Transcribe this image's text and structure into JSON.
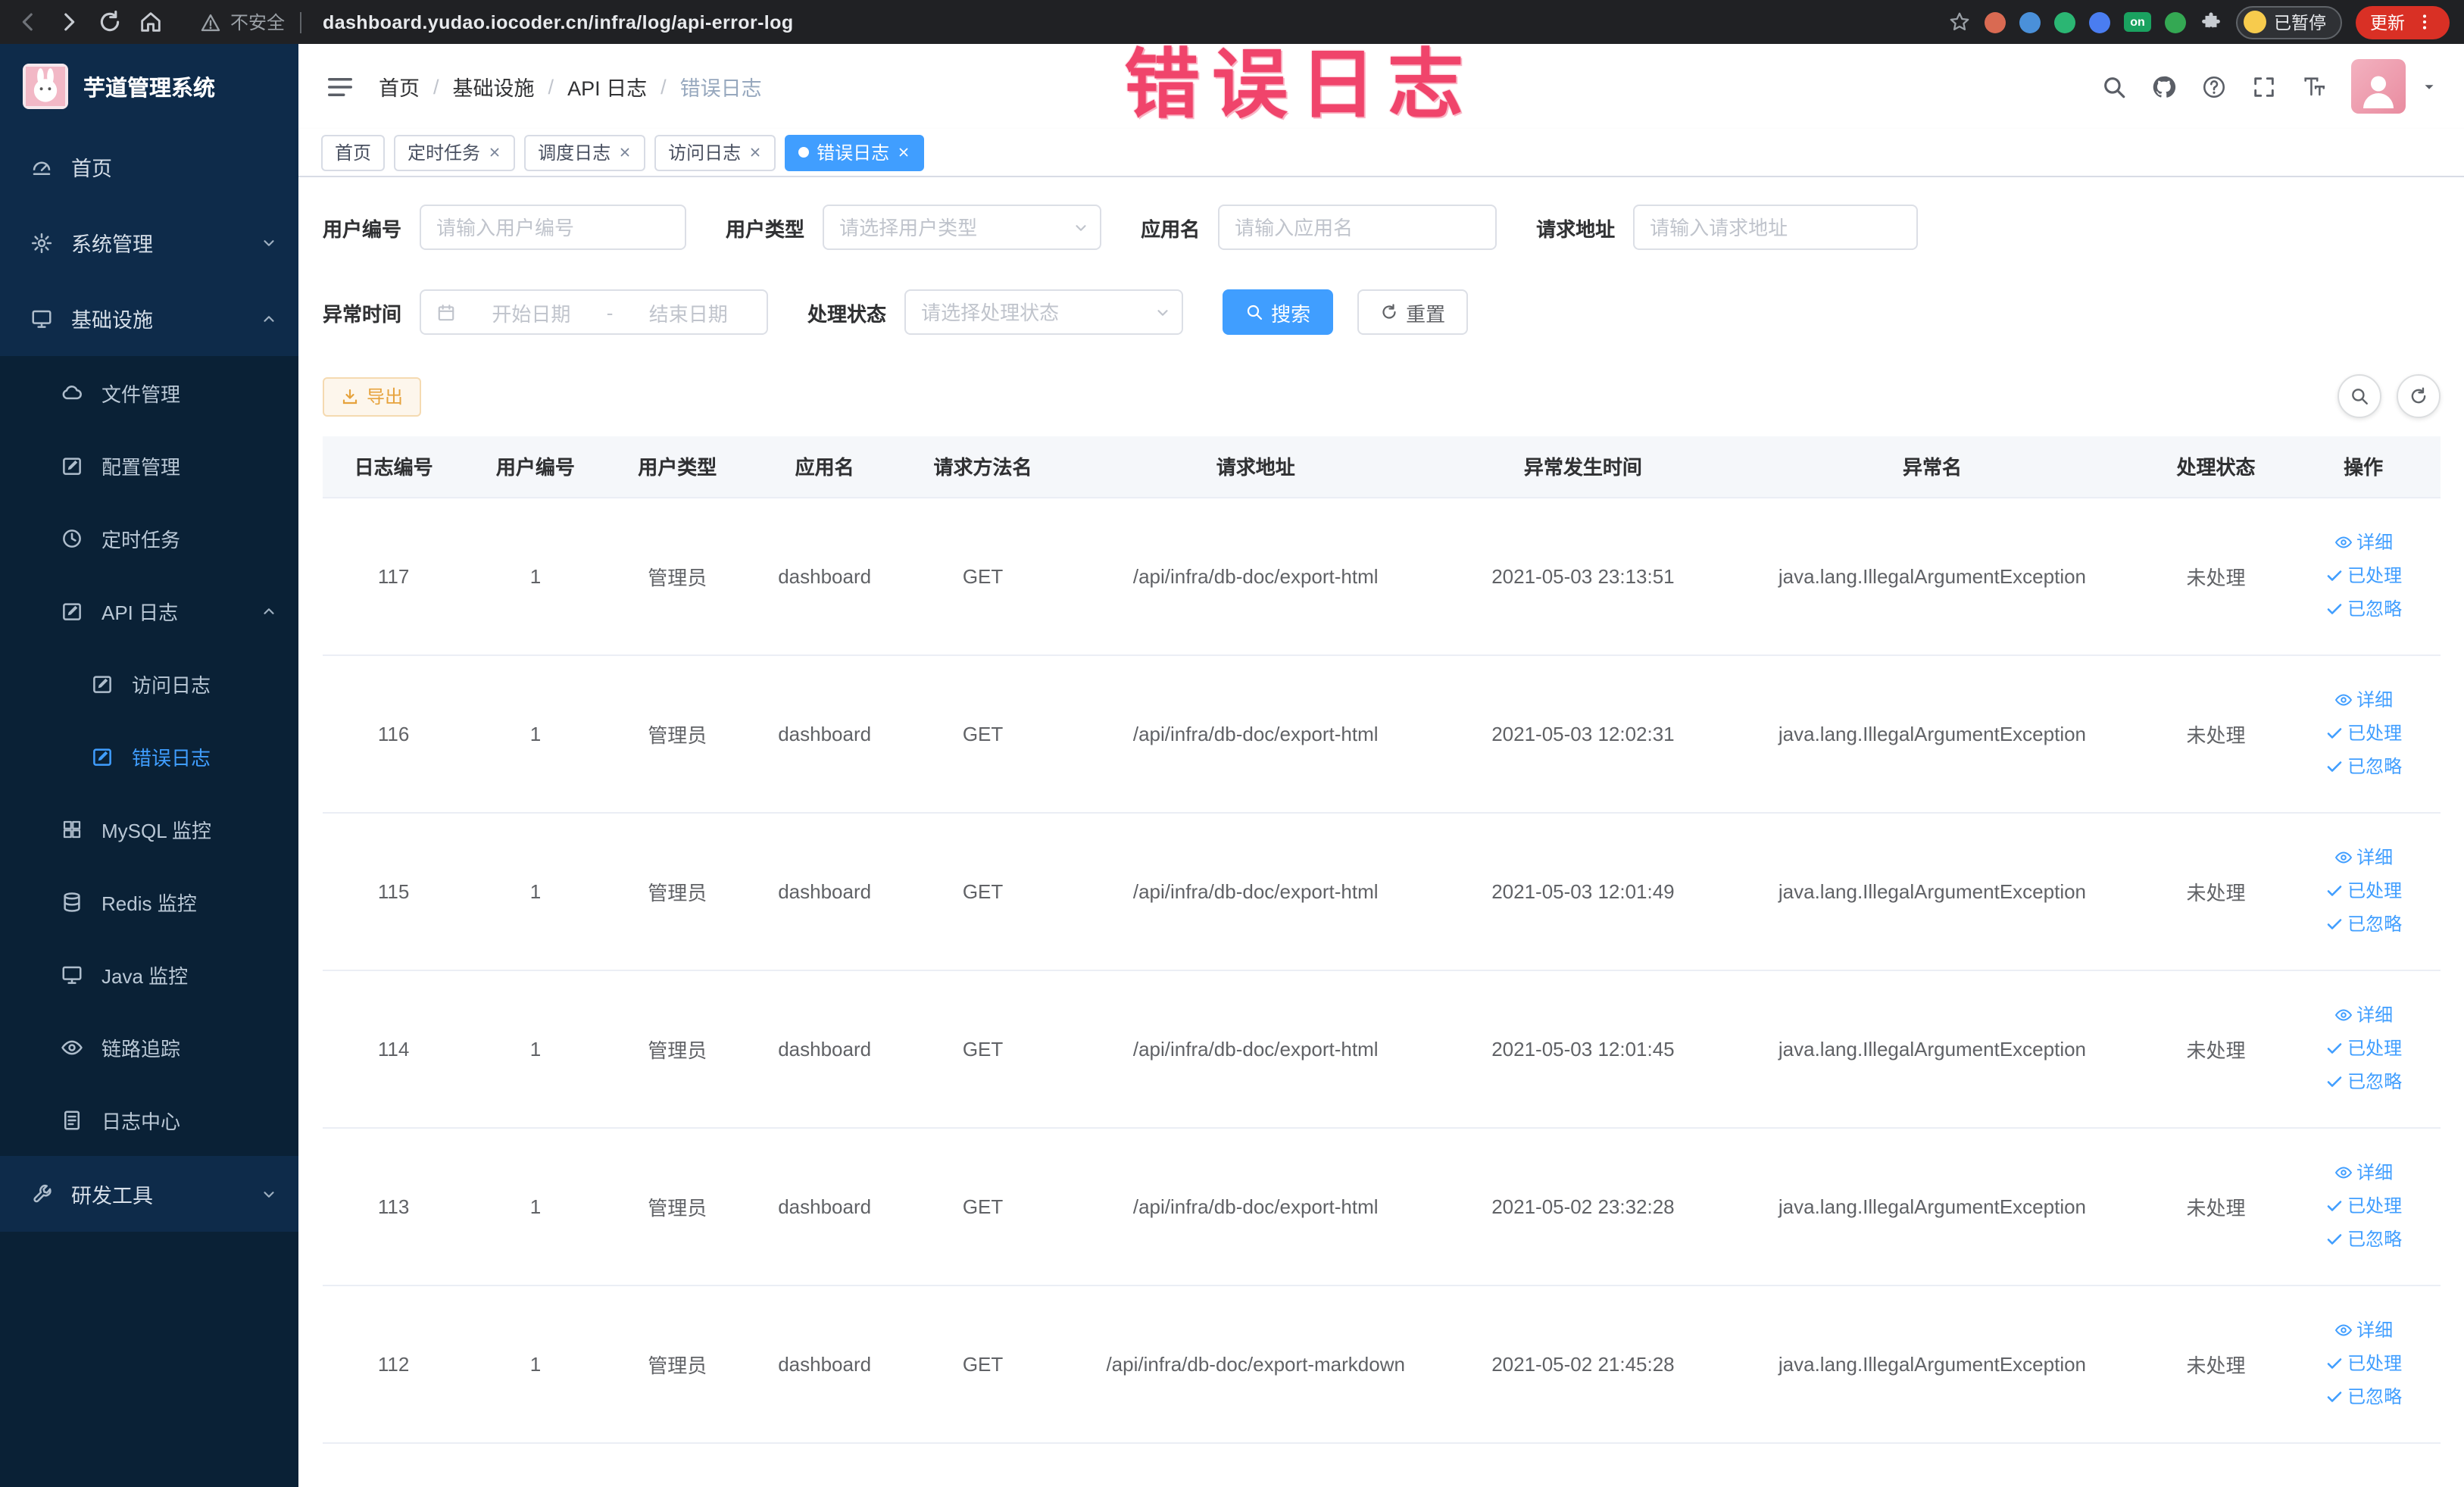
{
  "browser": {
    "security_label": "不安全",
    "url": "dashboard.yudao.iocoder.cn/infra/log/api-error-log",
    "profile_chip": "已暂停",
    "update_button": "更新"
  },
  "annotation": {
    "text": "错误日志",
    "color": "#f0446b"
  },
  "sidebar": {
    "app_title": "芋道管理系统",
    "items": [
      {
        "label": "首页"
      },
      {
        "label": "系统管理"
      },
      {
        "label": "基础设施"
      },
      {
        "label": "文件管理"
      },
      {
        "label": "配置管理"
      },
      {
        "label": "定时任务"
      },
      {
        "label": "API 日志"
      },
      {
        "label": "访问日志"
      },
      {
        "label": "错误日志"
      },
      {
        "label": "MySQL 监控"
      },
      {
        "label": "Redis 监控"
      },
      {
        "label": "Java 监控"
      },
      {
        "label": "链路追踪"
      },
      {
        "label": "日志中心"
      },
      {
        "label": "研发工具"
      }
    ]
  },
  "breadcrumb": {
    "items": [
      "首页",
      "基础设施",
      "API 日志",
      "错误日志"
    ]
  },
  "tabs": [
    {
      "label": "首页"
    },
    {
      "label": "定时任务"
    },
    {
      "label": "调度日志"
    },
    {
      "label": "访问日志"
    },
    {
      "label": "错误日志"
    }
  ],
  "filters": {
    "user_id": {
      "label": "用户编号",
      "placeholder": "请输入用户编号",
      "value": ""
    },
    "user_type": {
      "label": "用户类型",
      "placeholder": "请选择用户类型",
      "value": ""
    },
    "app_name": {
      "label": "应用名",
      "placeholder": "请输入应用名",
      "value": ""
    },
    "request_url": {
      "label": "请求地址",
      "placeholder": "请输入请求地址",
      "value": ""
    },
    "exception_time": {
      "label": "异常时间",
      "start_placeholder": "开始日期",
      "separator": "-",
      "end_placeholder": "结束日期"
    },
    "process_status": {
      "label": "处理状态",
      "placeholder": "请选择处理状态",
      "value": ""
    },
    "search_button": "搜索",
    "reset_button": "重置"
  },
  "toolbar": {
    "export_button": "导出"
  },
  "table": {
    "columns": [
      "日志编号",
      "用户编号",
      "用户类型",
      "应用名",
      "请求方法名",
      "请求地址",
      "异常发生时间",
      "异常名",
      "处理状态",
      "操作"
    ],
    "action_labels": {
      "detail": "详细",
      "processed": "已处理",
      "ignored": "已忽略"
    },
    "rows": [
      {
        "id": "117",
        "user_id": "1",
        "user_type": "管理员",
        "app_name": "dashboard",
        "method": "GET",
        "url": "/api/infra/db-doc/export-html",
        "time": "2021-05-03 23:13:51",
        "exception": "java.lang.IllegalArgumentException",
        "status": "未处理"
      },
      {
        "id": "116",
        "user_id": "1",
        "user_type": "管理员",
        "app_name": "dashboard",
        "method": "GET",
        "url": "/api/infra/db-doc/export-html",
        "time": "2021-05-03 12:02:31",
        "exception": "java.lang.IllegalArgumentException",
        "status": "未处理"
      },
      {
        "id": "115",
        "user_id": "1",
        "user_type": "管理员",
        "app_name": "dashboard",
        "method": "GET",
        "url": "/api/infra/db-doc/export-html",
        "time": "2021-05-03 12:01:49",
        "exception": "java.lang.IllegalArgumentException",
        "status": "未处理"
      },
      {
        "id": "114",
        "user_id": "1",
        "user_type": "管理员",
        "app_name": "dashboard",
        "method": "GET",
        "url": "/api/infra/db-doc/export-html",
        "time": "2021-05-03 12:01:45",
        "exception": "java.lang.IllegalArgumentException",
        "status": "未处理"
      },
      {
        "id": "113",
        "user_id": "1",
        "user_type": "管理员",
        "app_name": "dashboard",
        "method": "GET",
        "url": "/api/infra/db-doc/export-html",
        "time": "2021-05-02 23:32:28",
        "exception": "java.lang.IllegalArgumentException",
        "status": "未处理"
      },
      {
        "id": "112",
        "user_id": "1",
        "user_type": "管理员",
        "app_name": "dashboard",
        "method": "GET",
        "url": "/api/infra/db-doc/export-markdown",
        "time": "2021-05-02 21:45:28",
        "exception": "java.lang.IllegalArgumentException",
        "status": "未处理"
      }
    ]
  }
}
